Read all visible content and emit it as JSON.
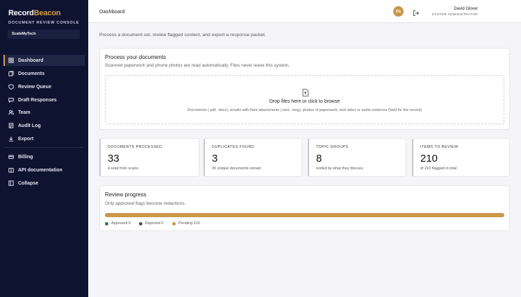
{
  "brand": {
    "name_part1": "Record",
    "name_part2": "Beacon",
    "subtitle": "DOCUMENT REVIEW CONSOLE",
    "org": "ScaleMyTech"
  },
  "nav": {
    "primary": [
      {
        "label": "Dashboard",
        "icon": "grid-icon",
        "active": true
      },
      {
        "label": "Documents",
        "icon": "documents-icon"
      },
      {
        "label": "Review Queue",
        "icon": "shield-icon"
      },
      {
        "label": "Draft Responses",
        "icon": "draft-icon"
      },
      {
        "label": "Team",
        "icon": "team-icon"
      },
      {
        "label": "Audit Log",
        "icon": "audit-icon"
      },
      {
        "label": "Export",
        "icon": "export-icon"
      }
    ],
    "secondary": [
      {
        "label": "Billing",
        "icon": "billing-icon"
      },
      {
        "label": "API documentation",
        "icon": "book-icon"
      },
      {
        "label": "Collapse",
        "icon": "collapse-icon"
      }
    ]
  },
  "header": {
    "title": "Dashboard",
    "user_name": "David Glover",
    "user_role": "SYSTEM ADMINISTRATOR",
    "avatar_initials": "DG"
  },
  "intro": "Process a document set, review flagged content, and export a response packet.",
  "upload": {
    "title": "Process your documents",
    "subtitle": "Scanned paperwork and phone photos are read automatically. Files never leave this system.",
    "drop_title": "Drop files here or click to browse",
    "drop_hint": "Documents (.pdf, .docx), emails with their attachments (.eml, .msg), photos of paperwork, and video or audio evidence (held for the record)"
  },
  "stats": [
    {
      "label": "DOCUMENTS PROCESSED",
      "value": "33",
      "sub": "4 read from scans"
    },
    {
      "label": "DUPLICATES FOUND",
      "value": "3",
      "sub": "30 unique documents remain"
    },
    {
      "label": "TOPIC GROUPS",
      "value": "8",
      "sub": "sorted by what they discuss"
    },
    {
      "label": "ITEMS TO REVIEW",
      "value": "210",
      "sub": "of 210 flagged in total"
    }
  ],
  "progress": {
    "title": "Review progress",
    "subtitle": "Only approved flags become redactions.",
    "pending_fraction": 1.0,
    "legend": {
      "approved": "Approved 0",
      "rejected": "Rejected 0",
      "pending": "Pending 210"
    },
    "colors": {
      "approved": "#3d7a3d",
      "rejected": "#555555",
      "pending": "#c9994a"
    }
  },
  "colors": {
    "sidebar": "#0e1330",
    "accent": "#d4a04a"
  }
}
